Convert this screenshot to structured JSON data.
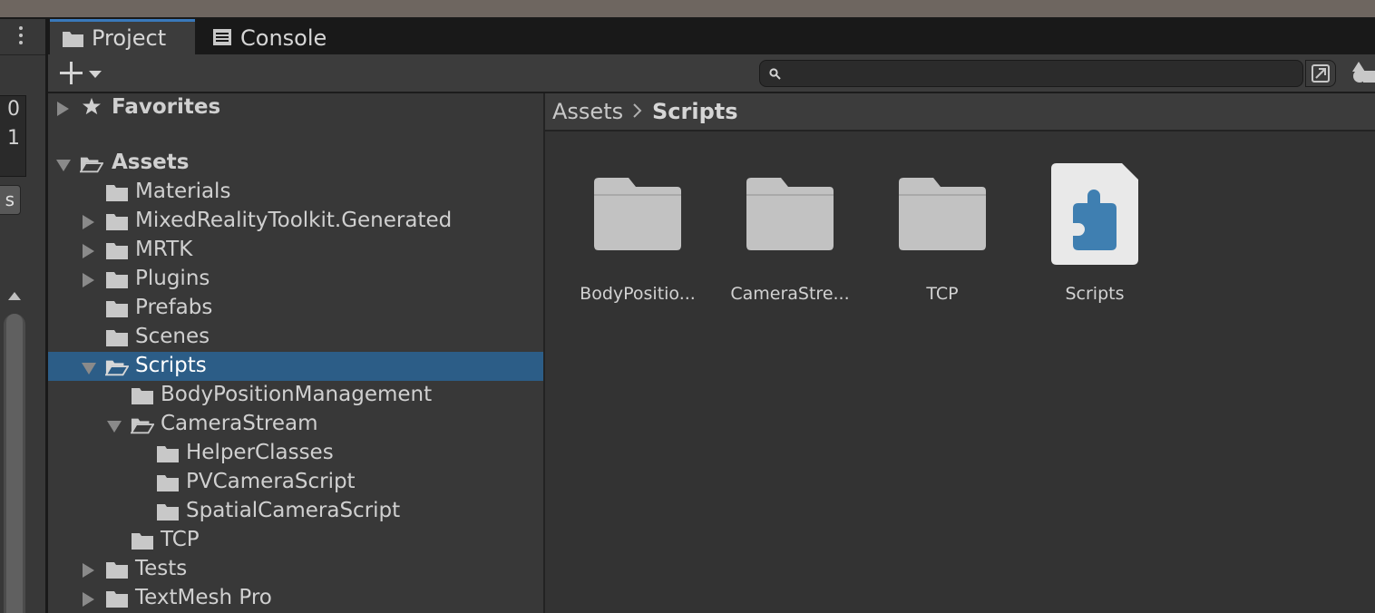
{
  "window": {
    "tabs": [
      {
        "label": "Project",
        "icon": "folder-icon",
        "active": true
      },
      {
        "label": "Console",
        "icon": "console-icon",
        "active": false
      }
    ]
  },
  "left_panel": {
    "numbers": [
      "0",
      "1"
    ],
    "button_label": "s"
  },
  "toolbar": {
    "search_value": "",
    "search_placeholder": ""
  },
  "tree": {
    "favorites_label": "Favorites",
    "assets_label": "Assets",
    "items": [
      {
        "label": "Materials"
      },
      {
        "label": "MixedRealityToolkit.Generated"
      },
      {
        "label": "MRTK"
      },
      {
        "label": "Plugins"
      },
      {
        "label": "Prefabs"
      },
      {
        "label": "Scenes"
      },
      {
        "label": "Scripts"
      },
      {
        "label": "BodyPositionManagement"
      },
      {
        "label": "CameraStream"
      },
      {
        "label": "HelperClasses"
      },
      {
        "label": "PVCameraScript"
      },
      {
        "label": "SpatialCameraScript"
      },
      {
        "label": "TCP"
      },
      {
        "label": "Tests"
      },
      {
        "label": "TextMesh Pro"
      }
    ],
    "selected": "Scripts"
  },
  "breadcrumb": {
    "root": "Assets",
    "current": "Scripts"
  },
  "assets": [
    {
      "name": "BodyPositio...",
      "type": "folder"
    },
    {
      "name": "CameraStre...",
      "type": "folder"
    },
    {
      "name": "TCP",
      "type": "folder"
    },
    {
      "name": "Scripts",
      "type": "assembly-definition"
    }
  ],
  "colors": {
    "selection": "#2c5d87",
    "tab_accent": "#3a79bb",
    "asmdef_blue": "#3f7fb1"
  }
}
